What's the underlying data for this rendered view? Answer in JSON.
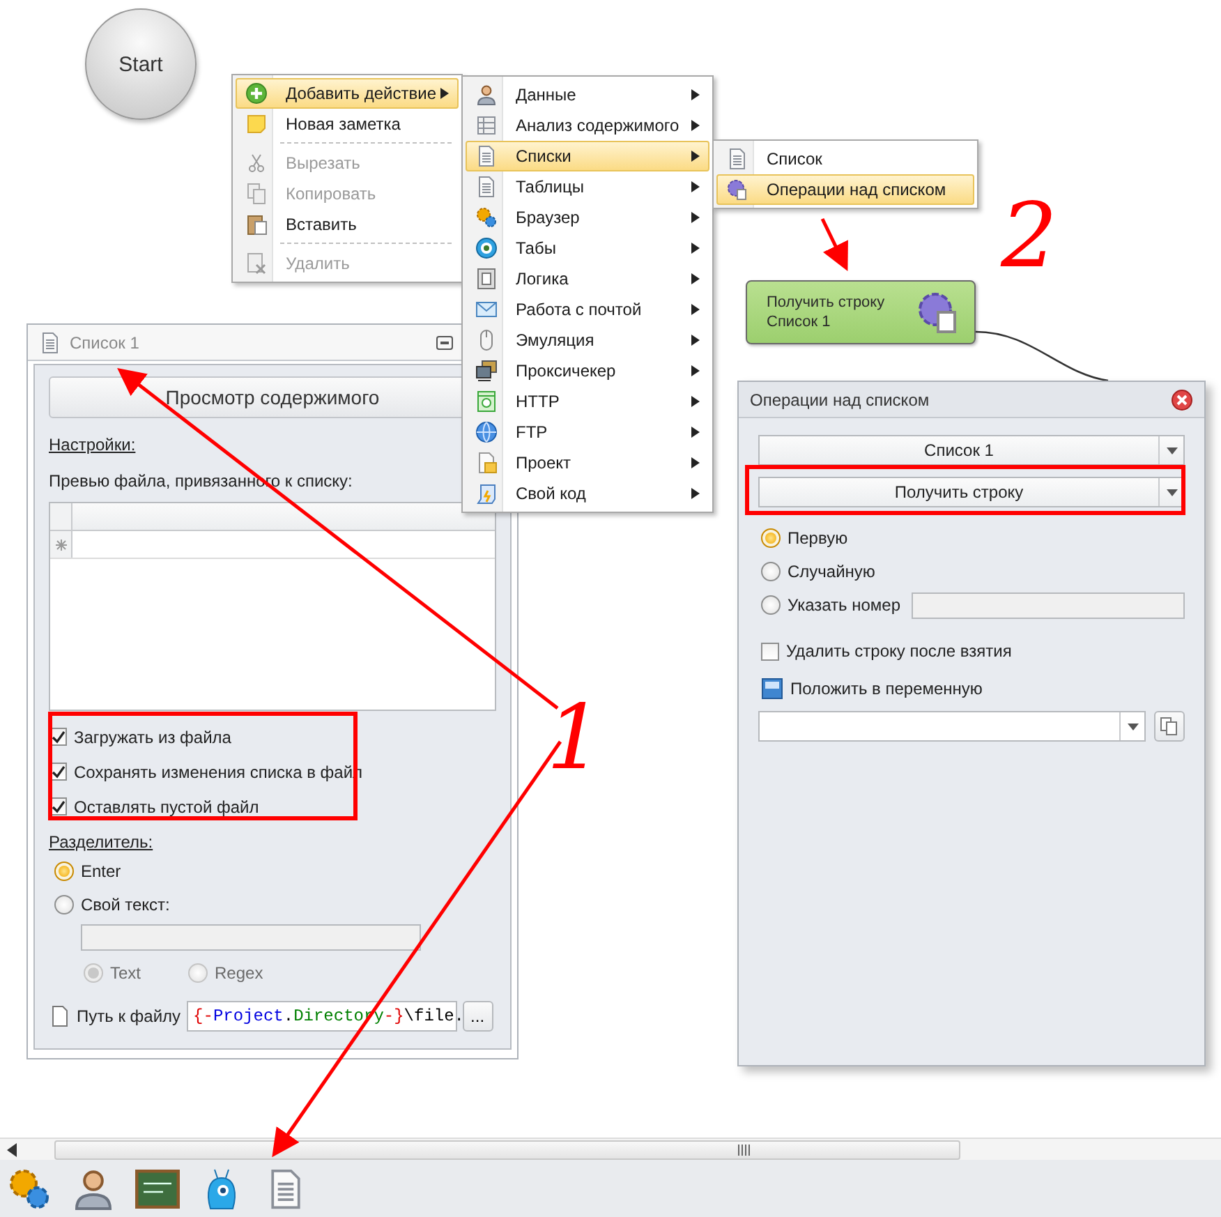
{
  "canvas": {
    "start_node": {
      "label": "Start"
    },
    "context_menu": {
      "items": [
        {
          "label": "Добавить действие",
          "selected": true,
          "disabled": false,
          "has_submenu": true,
          "separator_after": false
        },
        {
          "label": "Новая заметка",
          "selected": false,
          "disabled": false,
          "has_submenu": false,
          "separator_after": true
        },
        {
          "label": "Вырезать",
          "selected": false,
          "disabled": true,
          "has_submenu": false,
          "separator_after": false
        },
        {
          "label": "Копировать",
          "selected": false,
          "disabled": true,
          "has_submenu": false,
          "separator_after": false
        },
        {
          "label": "Вставить",
          "selected": false,
          "disabled": false,
          "has_submenu": false,
          "separator_after": true
        },
        {
          "label": "Удалить",
          "selected": false,
          "disabled": true,
          "has_submenu": false,
          "separator_after": false
        }
      ]
    },
    "actions_submenu": {
      "items": [
        {
          "label": "Данные",
          "selected": false
        },
        {
          "label": "Анализ содержимого",
          "selected": false
        },
        {
          "label": "Списки",
          "selected": true
        },
        {
          "label": "Таблицы",
          "selected": false
        },
        {
          "label": "Браузер",
          "selected": false
        },
        {
          "label": "Табы",
          "selected": false
        },
        {
          "label": "Логика",
          "selected": false
        },
        {
          "label": "Работа с почтой",
          "selected": false
        },
        {
          "label": "Эмуляция",
          "selected": false
        },
        {
          "label": "Проксичекер",
          "selected": false
        },
        {
          "label": "HTTP",
          "selected": false
        },
        {
          "label": "FTP",
          "selected": false
        },
        {
          "label": "Проект",
          "selected": false
        },
        {
          "label": "Свой код",
          "selected": false
        }
      ]
    },
    "lists_submenu": {
      "items": [
        {
          "label": "Список",
          "selected": false
        },
        {
          "label": "Операции над списком",
          "selected": true
        }
      ]
    },
    "action_node": {
      "title": "Получить строку",
      "subtitle": "Список 1"
    },
    "list_panel": {
      "title": "Список 1",
      "view_button": "Просмотр содержимого",
      "settings_label": "Настройки:",
      "preview_label": "Превью файла, привязанного к списку:",
      "checkboxes": [
        {
          "label": "Загружать из файла",
          "checked": true
        },
        {
          "label": "Сохранять изменения списка в файл",
          "checked": true
        },
        {
          "label": "Оставлять пустой файл",
          "checked": true
        }
      ],
      "separator_label": "Разделитель:",
      "separator_options": [
        {
          "label": "Enter",
          "selected": true
        },
        {
          "label": "Свой текст:",
          "selected": false
        }
      ],
      "match_options": [
        {
          "label": "Text",
          "selected": true,
          "disabled": true
        },
        {
          "label": "Regex",
          "selected": false,
          "disabled": true
        }
      ],
      "path_label": "Путь к файлу",
      "path_value": [
        {
          "text": "{-",
          "color": "#e00000"
        },
        {
          "text": "Project",
          "color": "#0000e0"
        },
        {
          "text": ".",
          "color": "#000000"
        },
        {
          "text": "Directory",
          "color": "#008000"
        },
        {
          "text": "-}",
          "color": "#e00000"
        },
        {
          "text": "\\file.",
          "color": "#000000"
        }
      ],
      "browse_button": "..."
    },
    "operations_panel": {
      "title": "Операции над списком",
      "list_select": "Список 1",
      "operation_select": "Получить строку",
      "options": [
        {
          "label": "Первую",
          "selected": true
        },
        {
          "label": "Случайную",
          "selected": false
        },
        {
          "label": "Указать номер",
          "selected": false
        }
      ],
      "delete_checkbox": {
        "label": "Удалить строку после взятия",
        "checked": false
      },
      "variable_label": "Положить в переменную"
    },
    "annotations": [
      {
        "text": "1"
      },
      {
        "text": "2"
      }
    ]
  }
}
